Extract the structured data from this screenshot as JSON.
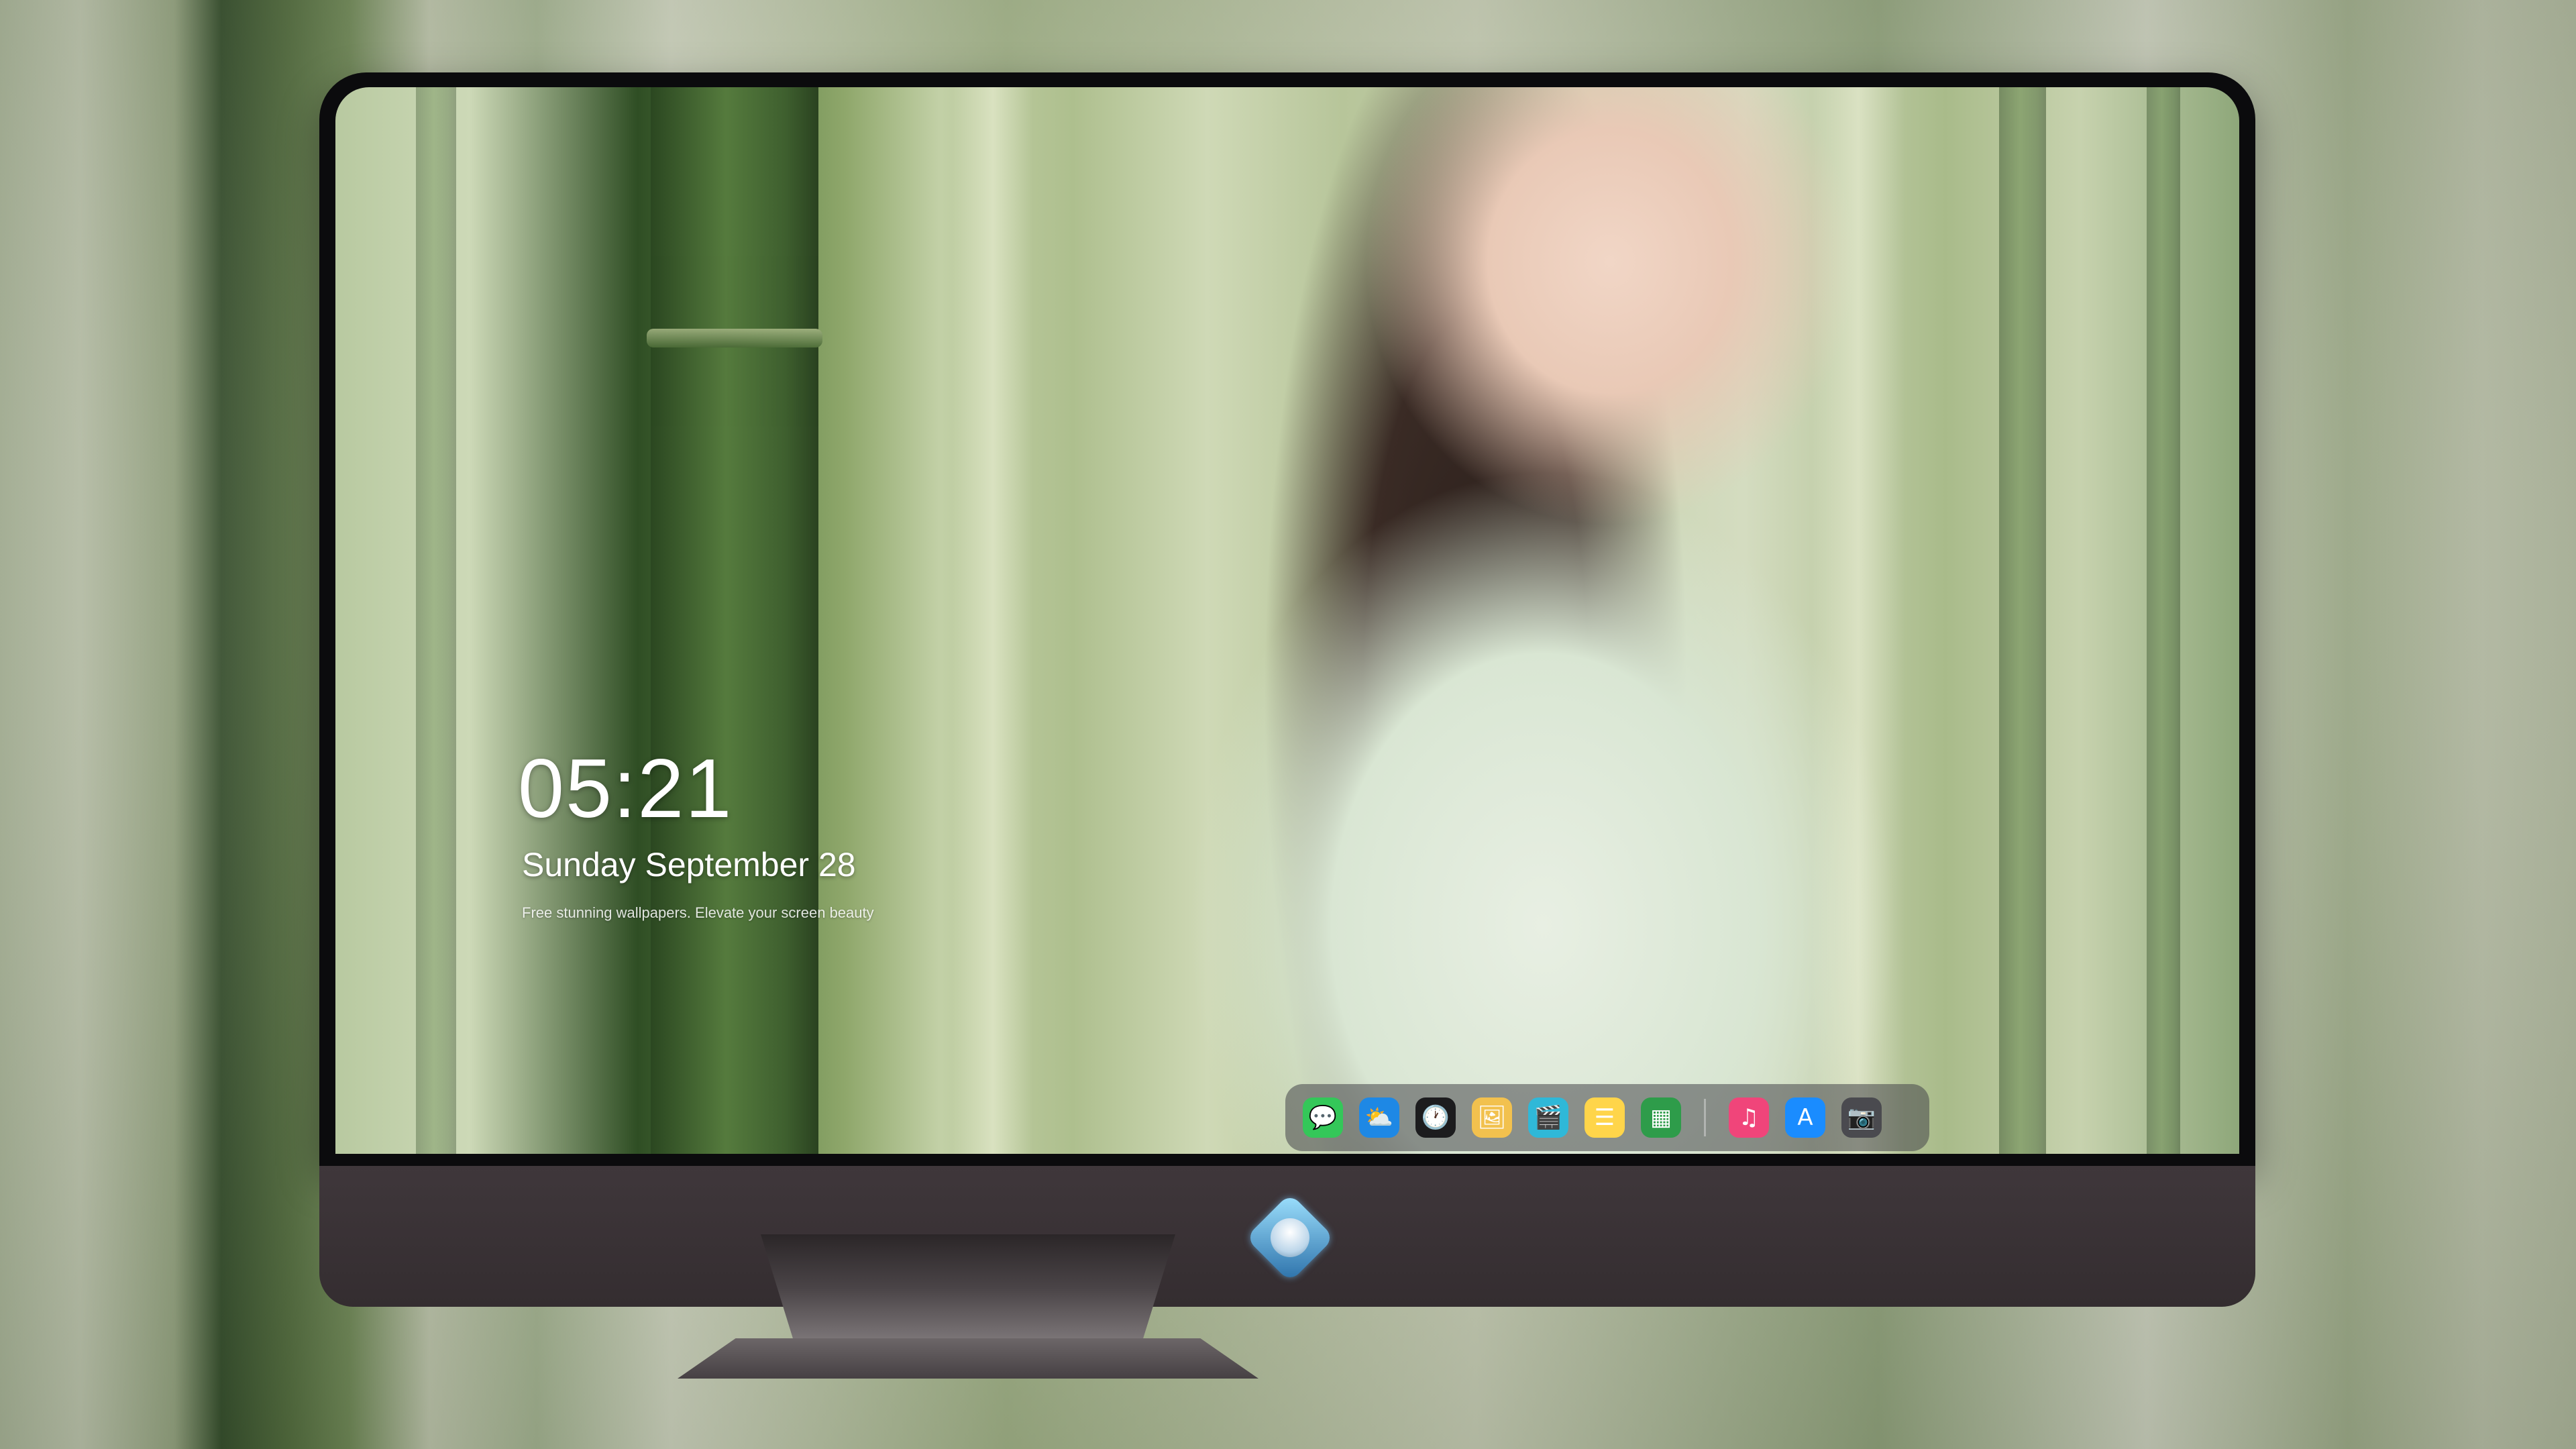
{
  "lock_screen": {
    "time": "05:21",
    "date": "Sunday September  28",
    "tagline": "Free stunning wallpapers. Elevate your screen beauty"
  },
  "dock": {
    "apps": [
      {
        "name": "Messages",
        "icon": "messages-icon",
        "glyph": "💬",
        "color": "#34c759"
      },
      {
        "name": "Weather",
        "icon": "weather-icon",
        "glyph": "⛅",
        "color": "#1e88e5"
      },
      {
        "name": "Clock",
        "icon": "clock-icon",
        "glyph": "🕐",
        "color": "#1c1c1e"
      },
      {
        "name": "Preview",
        "icon": "preview-icon",
        "glyph": "🖼",
        "color": "#f2c14e"
      },
      {
        "name": "Clips",
        "icon": "clips-icon",
        "glyph": "🎬",
        "color": "#2fb8d8"
      },
      {
        "name": "Notes",
        "icon": "notes-icon",
        "glyph": "☰",
        "color": "#ffd54a"
      },
      {
        "name": "Numbers",
        "icon": "numbers-icon",
        "glyph": "▦",
        "color": "#2e9c4a"
      },
      {
        "name": "Music",
        "icon": "music-icon",
        "glyph": "♫",
        "color": "#f0457a"
      },
      {
        "name": "App Store",
        "icon": "app-store-icon",
        "glyph": "A",
        "color": "#1a8cff"
      },
      {
        "name": "Camera",
        "icon": "camera-icon",
        "glyph": "📷",
        "color": "#4a4a4f"
      }
    ]
  },
  "colors": {
    "bezel": "#0b0b0d",
    "chin": "#3a3235",
    "dock_bg": "rgba(70,70,75,0.55)",
    "text": "#ffffff"
  }
}
